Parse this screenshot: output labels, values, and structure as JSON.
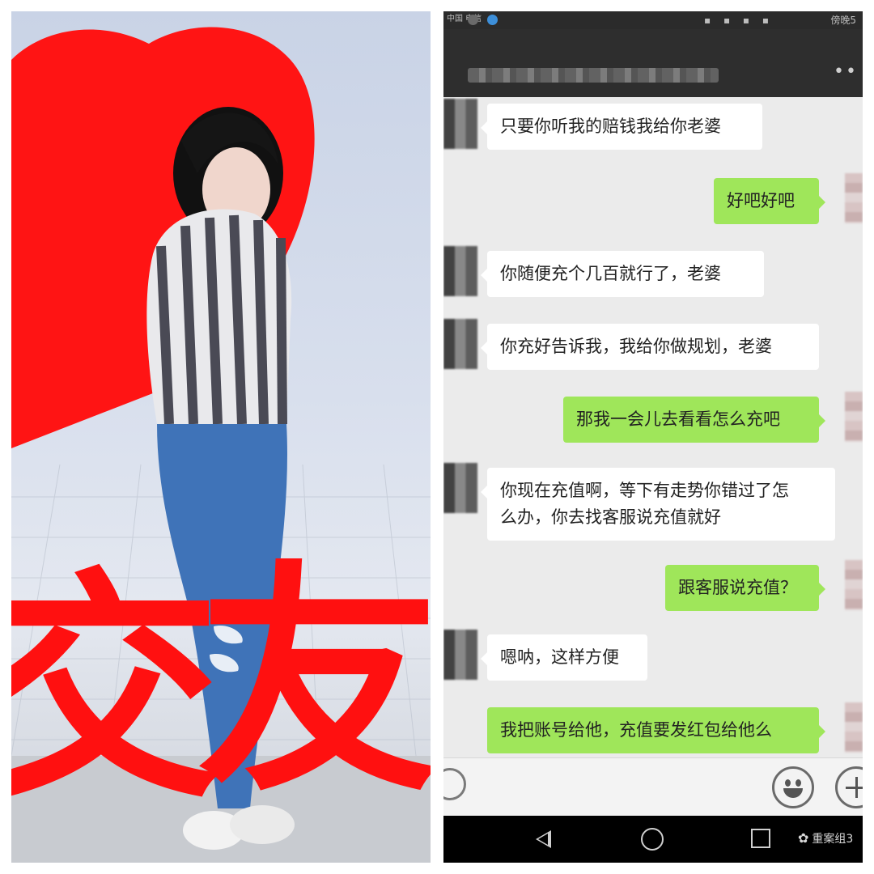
{
  "left_panel": {
    "banner_chars": [
      "交",
      "友"
    ]
  },
  "phone": {
    "status_bar": {
      "carrier": "中国\n电信",
      "time": "傍晚5"
    },
    "title_bar": {
      "more_icon": "more-icon"
    },
    "messages": [
      {
        "side": "in",
        "text": "只要你听我的赔钱我给你老婆"
      },
      {
        "side": "out",
        "text": "好吧好吧"
      },
      {
        "side": "in",
        "text": "你随便充个几百就行了，老婆"
      },
      {
        "side": "in",
        "text": "你充好告诉我，我给你做规划，老婆"
      },
      {
        "side": "out",
        "text": "那我一会儿去看看怎么充吧"
      },
      {
        "side": "in",
        "text": "你现在充值啊，等下有走势你错过了怎\n么办，你去找客服说充值就好"
      },
      {
        "side": "out",
        "text": "跟客服说充值？"
      },
      {
        "side": "in",
        "text": "嗯呐，这样方便"
      },
      {
        "side": "out",
        "text": "我把账号给他，充值要发红包给他么"
      }
    ],
    "input_bar": {
      "voice_icon": "voice-icon",
      "emoji_icon": "emoji-icon",
      "plus_icon": "plus-icon"
    },
    "nav_bar": {
      "back_icon": "back-icon",
      "home_icon": "home-icon",
      "recent_icon": "recent-apps-icon",
      "watermark": "重案组3"
    }
  }
}
